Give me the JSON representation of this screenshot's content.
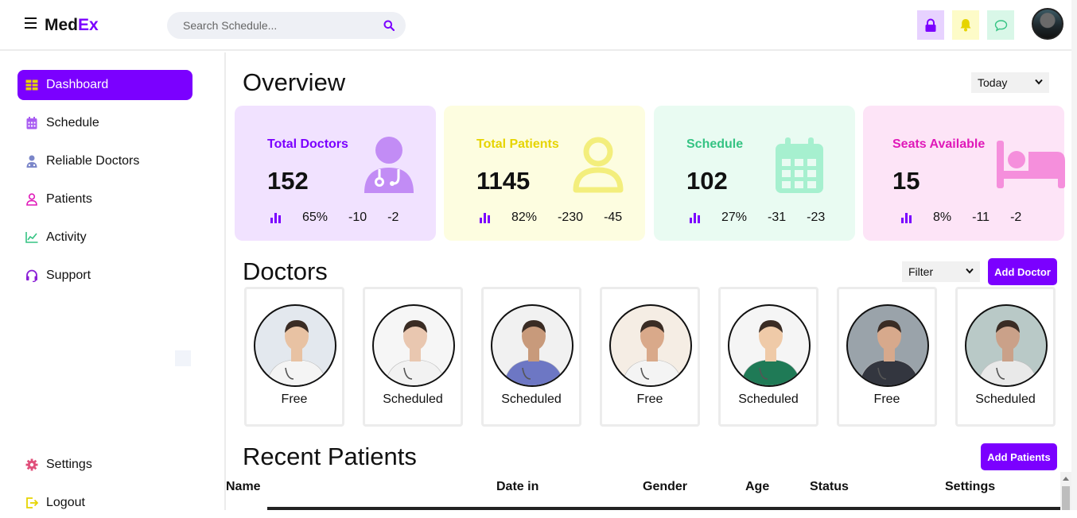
{
  "header": {
    "brand_part1": "Med",
    "brand_part2": "Ex",
    "search_placeholder": "Search Schedule...",
    "buttons": [
      {
        "name": "lock",
        "bg": "#e7d2ff",
        "color": "#7b00ff"
      },
      {
        "name": "bell",
        "bg": "#fdfbc8",
        "color": "#e6d400"
      },
      {
        "name": "chat",
        "bg": "#d9f7e8",
        "color": "#35c383"
      }
    ]
  },
  "sidebar": {
    "items": [
      {
        "label": "Dashboard",
        "icon": "table-icon",
        "active": true
      },
      {
        "label": "Schedule",
        "icon": "calendar-icon",
        "active": false
      },
      {
        "label": "Reliable Doctors",
        "icon": "doctor-icon",
        "active": false
      },
      {
        "label": "Patients",
        "icon": "user-icon",
        "active": false
      },
      {
        "label": "Activity",
        "icon": "chart-line-icon",
        "active": false
      },
      {
        "label": "Support",
        "icon": "headset-icon",
        "active": false
      }
    ],
    "bottom": [
      {
        "label": "Settings",
        "icon": "gear-icon"
      },
      {
        "label": "Logout",
        "icon": "logout-icon"
      }
    ]
  },
  "overview": {
    "title": "Overview",
    "period": "Today",
    "cards": [
      {
        "title": "Total Doctors",
        "value": "152",
        "percent": "65%",
        "delta1": "-10",
        "delta2": "-2",
        "bg": "#f1e2ff",
        "accent": "#7b00ff",
        "icon": "doctor-icon",
        "icon_color": "#c28cf5"
      },
      {
        "title": "Total Patients",
        "value": "1145",
        "percent": "82%",
        "delta1": "-230",
        "delta2": "-45",
        "bg": "#fdfde0",
        "accent": "#e6d400",
        "icon": "user-icon",
        "icon_color": "#f3ee7c"
      },
      {
        "title": "Schedule",
        "value": "102",
        "percent": "27%",
        "delta1": "-31",
        "delta2": "-23",
        "bg": "#e9fbf2",
        "accent": "#35c383",
        "icon": "calendar-icon",
        "icon_color": "#a6f0cf"
      },
      {
        "title": "Seats Available",
        "value": "15",
        "percent": "8%",
        "delta1": "-11",
        "delta2": "-2",
        "bg": "#fde4f7",
        "accent": "#e019b9",
        "icon": "bed-icon",
        "icon_color": "#f58fdc"
      }
    ]
  },
  "doctors": {
    "title": "Doctors",
    "filter": "Filter",
    "add_label": "Add Doctor",
    "list": [
      {
        "status": "Free",
        "coat": "#f4f4f4",
        "bg": "#e3e8ee",
        "skin": "#e8c2a3"
      },
      {
        "status": "Scheduled",
        "coat": "#f2f2f2",
        "bg": "#f6f6f6",
        "skin": "#e9c7b0"
      },
      {
        "status": "Scheduled",
        "coat": "#6d77c4",
        "bg": "#f1f1f1",
        "skin": "#c89a7b"
      },
      {
        "status": "Free",
        "coat": "#f4f4f4",
        "bg": "#f5ede4",
        "skin": "#d9a98a"
      },
      {
        "status": "Scheduled",
        "coat": "#1f7a56",
        "bg": "#f5f5f5",
        "skin": "#efcaa8"
      },
      {
        "status": "Free",
        "coat": "#33363f",
        "bg": "#9aa3aa",
        "skin": "#d7a98c"
      },
      {
        "status": "Scheduled",
        "coat": "#e9e9e9",
        "bg": "#b9c9c7",
        "skin": "#caa189"
      }
    ]
  },
  "patients": {
    "title": "Recent Patients",
    "add_label": "Add Patients",
    "columns": [
      "Name",
      "Date in",
      "Gender",
      "Age",
      "Status",
      "Settings"
    ]
  }
}
